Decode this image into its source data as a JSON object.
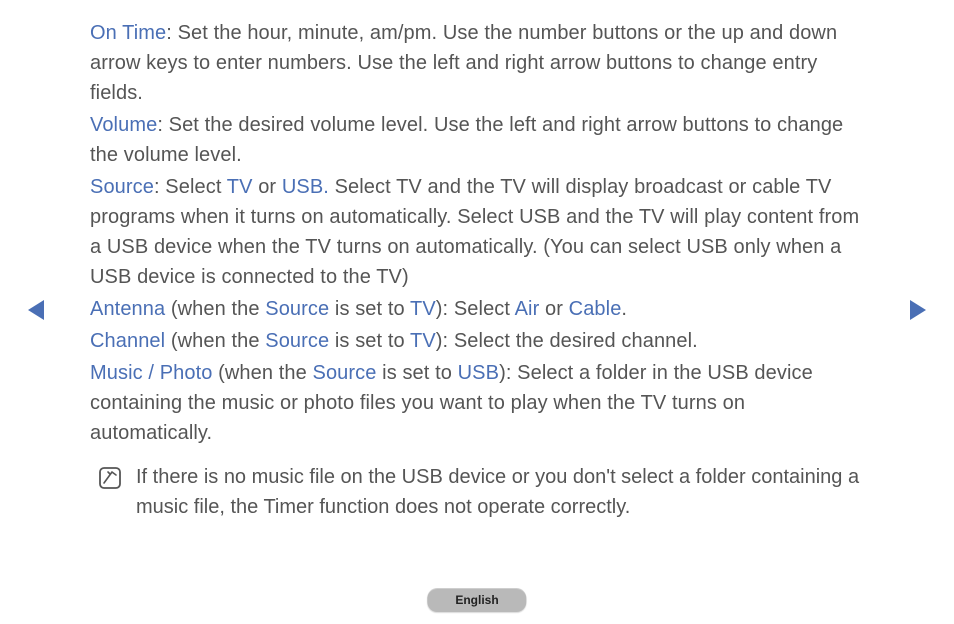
{
  "paragraphs": {
    "on_time": {
      "label": "On Time",
      "text": ": Set the hour, minute, am/pm. Use the number buttons or the up and down arrow keys to enter numbers. Use the left and right arrow buttons to change entry fields."
    },
    "volume": {
      "label": "Volume",
      "text": ": Set the desired volume level. Use the left and right arrow buttons to change the volume level."
    },
    "source": {
      "label": "Source",
      "pre": ": Select ",
      "tv": "TV",
      "mid": " or ",
      "usb": "USB.",
      "rest": " Select TV and the TV will display broadcast or cable TV programs when it turns on automatically. Select USB and the TV will play content from a USB device when the TV turns on automatically. (You can select USB only when a USB device is connected to the TV)"
    },
    "antenna": {
      "label": "Antenna",
      "p1": " (when the ",
      "src": "Source",
      "p2": " is set to ",
      "tv": "TV",
      "p3": "): Select ",
      "air": "Air",
      "p4": " or ",
      "cable": "Cable",
      "p5": "."
    },
    "channel": {
      "label": "Channel",
      "p1": " (when the ",
      "src": "Source",
      "p2": " is set to ",
      "tv": "TV",
      "p3": "): Select the desired channel."
    },
    "music": {
      "label": "Music / Photo",
      "p1": " (when the ",
      "src": "Source",
      "p2": " is set to ",
      "usb": "USB",
      "p3": "): Select a folder in the USB device containing the music or photo files you want to play when the TV turns on automatically."
    }
  },
  "note": "If there is no music file on the USB device or you don't select a folder containing a music file, the Timer function does not operate correctly.",
  "language": "English"
}
